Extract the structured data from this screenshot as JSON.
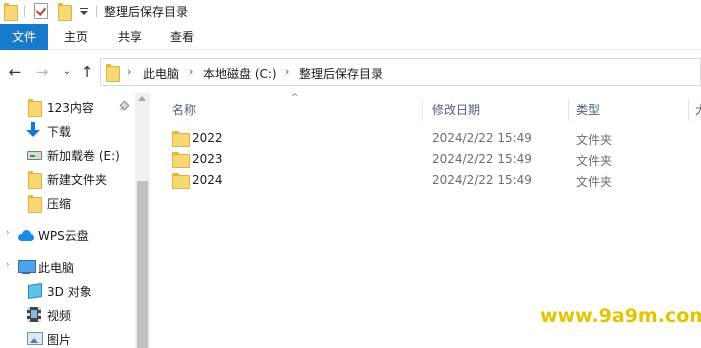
{
  "window": {
    "title": "整理后保存目录"
  },
  "ribbon": {
    "tabs": [
      "文件",
      "主页",
      "共享",
      "查看"
    ]
  },
  "address": {
    "crumbs": [
      "此电脑",
      "本地磁盘 (C:)",
      "整理后保存目录"
    ]
  },
  "navpane": {
    "items": [
      {
        "label": "123内容",
        "icon": "folder-icon",
        "pinned": true
      },
      {
        "label": "下载",
        "icon": "download-icon"
      },
      {
        "label": "新加载卷 (E:)",
        "icon": "drive-icon"
      },
      {
        "label": "新建文件夹",
        "icon": "folder-icon"
      },
      {
        "label": "压缩",
        "icon": "folder-icon"
      },
      {
        "label": "WPS云盘",
        "icon": "cloud-icon"
      },
      {
        "label": "此电脑",
        "icon": "computer-icon"
      },
      {
        "label": "3D 对象",
        "icon": "cube-icon"
      },
      {
        "label": "视频",
        "icon": "video-icon"
      },
      {
        "label": "图片",
        "icon": "picture-icon"
      }
    ]
  },
  "columns": {
    "name": "名称",
    "date": "修改日期",
    "type": "类型",
    "size": "大"
  },
  "files": [
    {
      "name": "2022",
      "date": "2024/2/22 15:49",
      "type": "文件夹"
    },
    {
      "name": "2023",
      "date": "2024/2/22 15:49",
      "type": "文件夹"
    },
    {
      "name": "2024",
      "date": "2024/2/22 15:49",
      "type": "文件夹"
    }
  ],
  "watermark": "www.9a9m.com",
  "colors": {
    "accent": "#1979ca",
    "folder": "#f8d775",
    "watermark": "#e4c400"
  }
}
